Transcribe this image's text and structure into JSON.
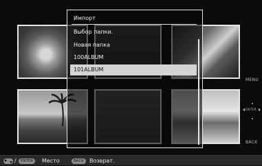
{
  "dialog": {
    "title": "Импорт",
    "subtitle": "Выбор папки.",
    "items": [
      {
        "label": "Новая папка",
        "selected": false
      },
      {
        "label": "100ALBUM",
        "selected": false
      },
      {
        "label": "101ALBUM",
        "selected": true
      }
    ]
  },
  "side_controls": {
    "menu_label": "MENU",
    "enter_label": "ENTER",
    "back_label": "BACK"
  },
  "footer": {
    "arrows_icon": "updown-arrows-icon",
    "slash": "/",
    "enter_key": "ENTER",
    "enter_text": "Место",
    "back_key": "BACK",
    "back_text": "Возврат."
  },
  "colors": {
    "background": "#0b0b0b",
    "border": "#e8e8e8",
    "selection": "#d4d4d4",
    "footer_bar": "#2a2a2a",
    "key_pill": "#8e8e8e"
  }
}
